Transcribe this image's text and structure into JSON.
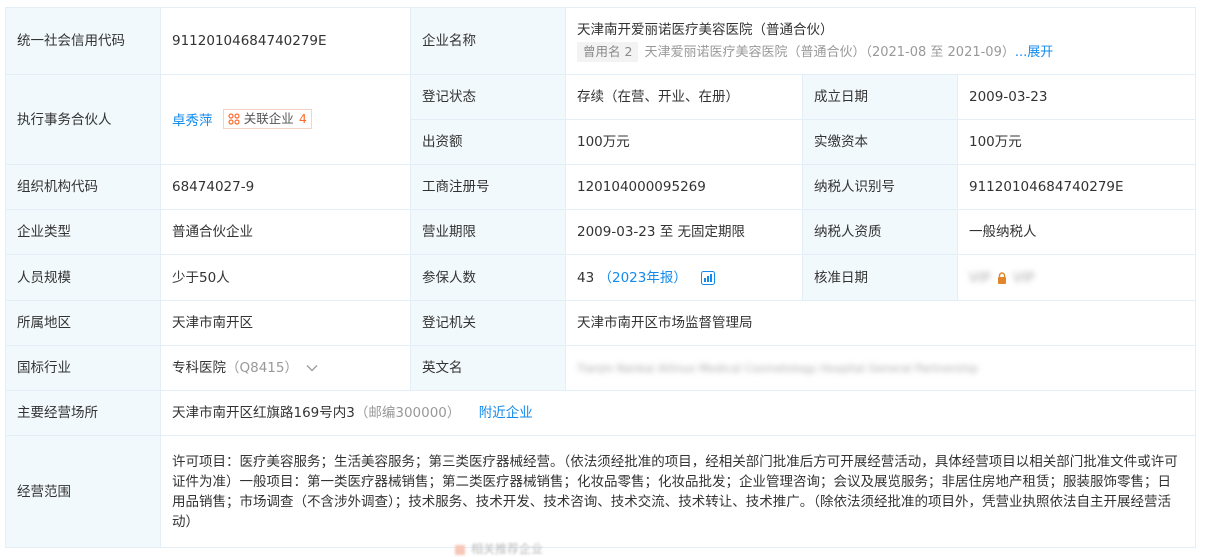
{
  "rows": {
    "credit_code": {
      "label": "统一社会信用代码",
      "value": "91120104684740279E"
    },
    "company_name": {
      "label": "企业名称",
      "value": "天津南开爱丽诺医疗美容医院（普通合伙）",
      "former_tag": "曾用名 2",
      "former_name": "天津爱丽诺医疗美容医院（普通合伙）",
      "former_period": "（2021-08 至 2021-09）",
      "expand": "...展开"
    },
    "partner": {
      "label": "执行事务合伙人",
      "name": "卓秀萍",
      "related_label": "关联企业",
      "related_count": "4"
    },
    "reg_status": {
      "label": "登记状态",
      "value": "存续（在营、开业、在册）"
    },
    "founded": {
      "label": "成立日期",
      "value": "2009-03-23"
    },
    "contribution": {
      "label": "出资额",
      "value": "100万元"
    },
    "paid_capital": {
      "label": "实缴资本",
      "value": "100万元"
    },
    "org_code": {
      "label": "组织机构代码",
      "value": "68474027-9"
    },
    "biz_reg_no": {
      "label": "工商注册号",
      "value": "120104000095269"
    },
    "taxpayer_id": {
      "label": "纳税人识别号",
      "value": "91120104684740279E"
    },
    "company_type": {
      "label": "企业类型",
      "value": "普通合伙企业"
    },
    "biz_period": {
      "label": "营业期限",
      "value": "2009-03-23 至 无固定期限"
    },
    "taxpayer_qual": {
      "label": "纳税人资质",
      "value": "一般纳税人"
    },
    "staff_size": {
      "label": "人员规模",
      "value": "少于50人"
    },
    "insured": {
      "label": "参保人数",
      "value": "43",
      "report": "（2023年报）"
    },
    "approve_date": {
      "label": "核准日期",
      "blur_left": "VIP",
      "blur_right": "VIP"
    },
    "region": {
      "label": "所属地区",
      "value": "天津市南开区"
    },
    "reg_authority": {
      "label": "登记机关",
      "value": "天津市南开区市场监督管理局"
    },
    "industry": {
      "label": "国标行业",
      "value": "专科医院",
      "code": "（Q8415）"
    },
    "english_name": {
      "label": "英文名",
      "blurred": "Tianjin Nankai Ailinuo Medical Cosmetology Hospital General Partnership"
    },
    "address": {
      "label": "主要经营场所",
      "value": "天津市南开区红旗路169号内3",
      "postcode": "（邮编300000）",
      "nearby": "附近企业"
    },
    "scope": {
      "label": "经营范围",
      "value": "许可项目：医疗美容服务；生活美容服务；第三类医疗器械经营。（依法须经批准的项目，经相关部门批准后方可开展经营活动，具体经营项目以相关部门批准文件或许可证件为准）一般项目：第一类医疗器械销售；第二类医疗器械销售；化妆品零售；化妆品批发；企业管理咨询；会议及展览服务；非居住房地产租赁；服装服饰零售；日用品销售；市场调查（不含涉外调查）；技术服务、技术开发、技术咨询、技术交流、技术转让、技术推广。（除依法须经批准的项目外，凭营业执照依法自主开展经营活动）"
    }
  },
  "footer_ghost": "相关推荐企业",
  "colors": {
    "label_bg": "#f2f9fc",
    "border": "#e4eef6",
    "link": "#128bed",
    "accent_orange": "#ff6b2e",
    "muted": "#999999"
  },
  "icons": {
    "related": "relate-network-icon",
    "report_chart": "chart-icon",
    "lock": "lock-icon",
    "chevron": "chevron-down-icon"
  }
}
